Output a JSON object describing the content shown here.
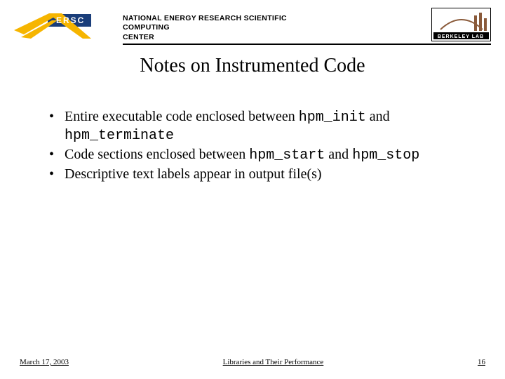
{
  "header": {
    "org_line1": "NATIONAL ENERGY RESEARCH SCIENTIFIC COMPUTING",
    "org_line2": "CENTER",
    "left_logo_text": "ERSC",
    "right_logo_text": "BERKELEY LAB"
  },
  "title": "Notes on Instrumented Code",
  "bullets": [
    {
      "pre": "Entire executable code enclosed between ",
      "code1": "hpm_init",
      "mid": " and ",
      "code2": "hpm_terminate",
      "post": ""
    },
    {
      "pre": "Code sections enclosed between ",
      "code1": "hpm_start",
      "mid": " and ",
      "code2": "hpm_stop",
      "post": ""
    },
    {
      "pre": "Descriptive text labels appear in output file(s)",
      "code1": "",
      "mid": "",
      "code2": "",
      "post": ""
    }
  ],
  "footer": {
    "date": "March 17, 2003",
    "center": "Libraries and Their Performance",
    "page": "16"
  },
  "colors": {
    "nersc_yellow": "#f6b500",
    "nersc_blue": "#1a3e7a"
  }
}
